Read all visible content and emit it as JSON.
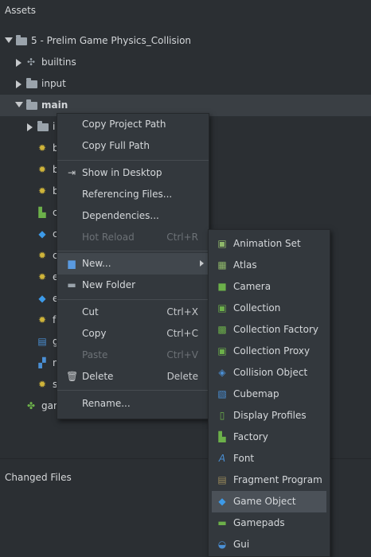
{
  "assets_panel": {
    "title": "Assets"
  },
  "tree": {
    "project": "5 - Prelim Game Physics_Collision",
    "builtins": "builtins",
    "input": "input",
    "main": "main",
    "main_children": [
      {
        "label": "i",
        "icon": "folder-icon"
      },
      {
        "label": "b",
        "icon": "script-gear-icon"
      },
      {
        "label": "b",
        "icon": "script-gear-icon"
      },
      {
        "label": "b",
        "icon": "script-gear-icon"
      },
      {
        "label": "c",
        "icon": "collection-icon"
      },
      {
        "label": "c",
        "icon": "game-object-icon"
      },
      {
        "label": "c",
        "icon": "script-gear-icon"
      },
      {
        "label": "e",
        "icon": "script-gear-icon"
      },
      {
        "label": "e",
        "icon": "game-object-icon"
      },
      {
        "label": "f",
        "icon": "script-gear-icon"
      },
      {
        "label": "g",
        "icon": "gui-icon"
      },
      {
        "label": "n",
        "icon": "tilemap-icon"
      },
      {
        "label": "s",
        "icon": "script-gear-icon"
      }
    ],
    "game_project": "gam"
  },
  "context_menu": {
    "copy_project_path": "Copy Project Path",
    "copy_full_path": "Copy Full Path",
    "show_in_desktop": "Show in Desktop",
    "referencing_files": "Referencing Files...",
    "dependencies": "Dependencies...",
    "hot_reload": "Hot Reload",
    "hot_reload_shortcut": "Ctrl+R",
    "new": "New...",
    "new_folder": "New Folder",
    "cut": "Cut",
    "cut_shortcut": "Ctrl+X",
    "copy": "Copy",
    "copy_shortcut": "Ctrl+C",
    "paste": "Paste",
    "paste_shortcut": "Ctrl+V",
    "delete": "Delete",
    "delete_shortcut": "Delete",
    "rename": "Rename..."
  },
  "new_submenu": [
    {
      "label": "Animation Set",
      "icon": "animation-set-icon",
      "color": "#8fb86a"
    },
    {
      "label": "Atlas",
      "icon": "atlas-icon",
      "color": "#8fb86a"
    },
    {
      "label": "Camera",
      "icon": "camera-icon",
      "color": "#6cb04a"
    },
    {
      "label": "Collection",
      "icon": "collection-icon",
      "color": "#6cb04a"
    },
    {
      "label": "Collection Factory",
      "icon": "collection-factory-icon",
      "color": "#6cb04a"
    },
    {
      "label": "Collection Proxy",
      "icon": "collection-proxy-icon",
      "color": "#6cb04a"
    },
    {
      "label": "Collision Object",
      "icon": "collision-object-icon",
      "color": "#4a8fd4"
    },
    {
      "label": "Cubemap",
      "icon": "cubemap-icon",
      "color": "#4a8fd4"
    },
    {
      "label": "Display Profiles",
      "icon": "display-profiles-icon",
      "color": "#6cb04a"
    },
    {
      "label": "Factory",
      "icon": "factory-icon",
      "color": "#6cb04a"
    },
    {
      "label": "Font",
      "icon": "font-icon",
      "color": "#4a8fd4"
    },
    {
      "label": "Fragment Program",
      "icon": "fragment-program-icon",
      "color": "#9a8a5a"
    },
    {
      "label": "Game Object",
      "icon": "game-object-icon",
      "color": "#3d9ae8"
    },
    {
      "label": "Gamepads",
      "icon": "gamepads-icon",
      "color": "#6cb04a"
    },
    {
      "label": "Gui",
      "icon": "gui-icon",
      "color": "#4a8fd4"
    }
  ],
  "changed_files": {
    "title": "Changed Files"
  },
  "colors": {
    "background": "#2b2f33",
    "menu": "#33383d",
    "highlight": "#4b5158",
    "script_gear": "#cfb43a",
    "folder": "#9aa3ab"
  }
}
